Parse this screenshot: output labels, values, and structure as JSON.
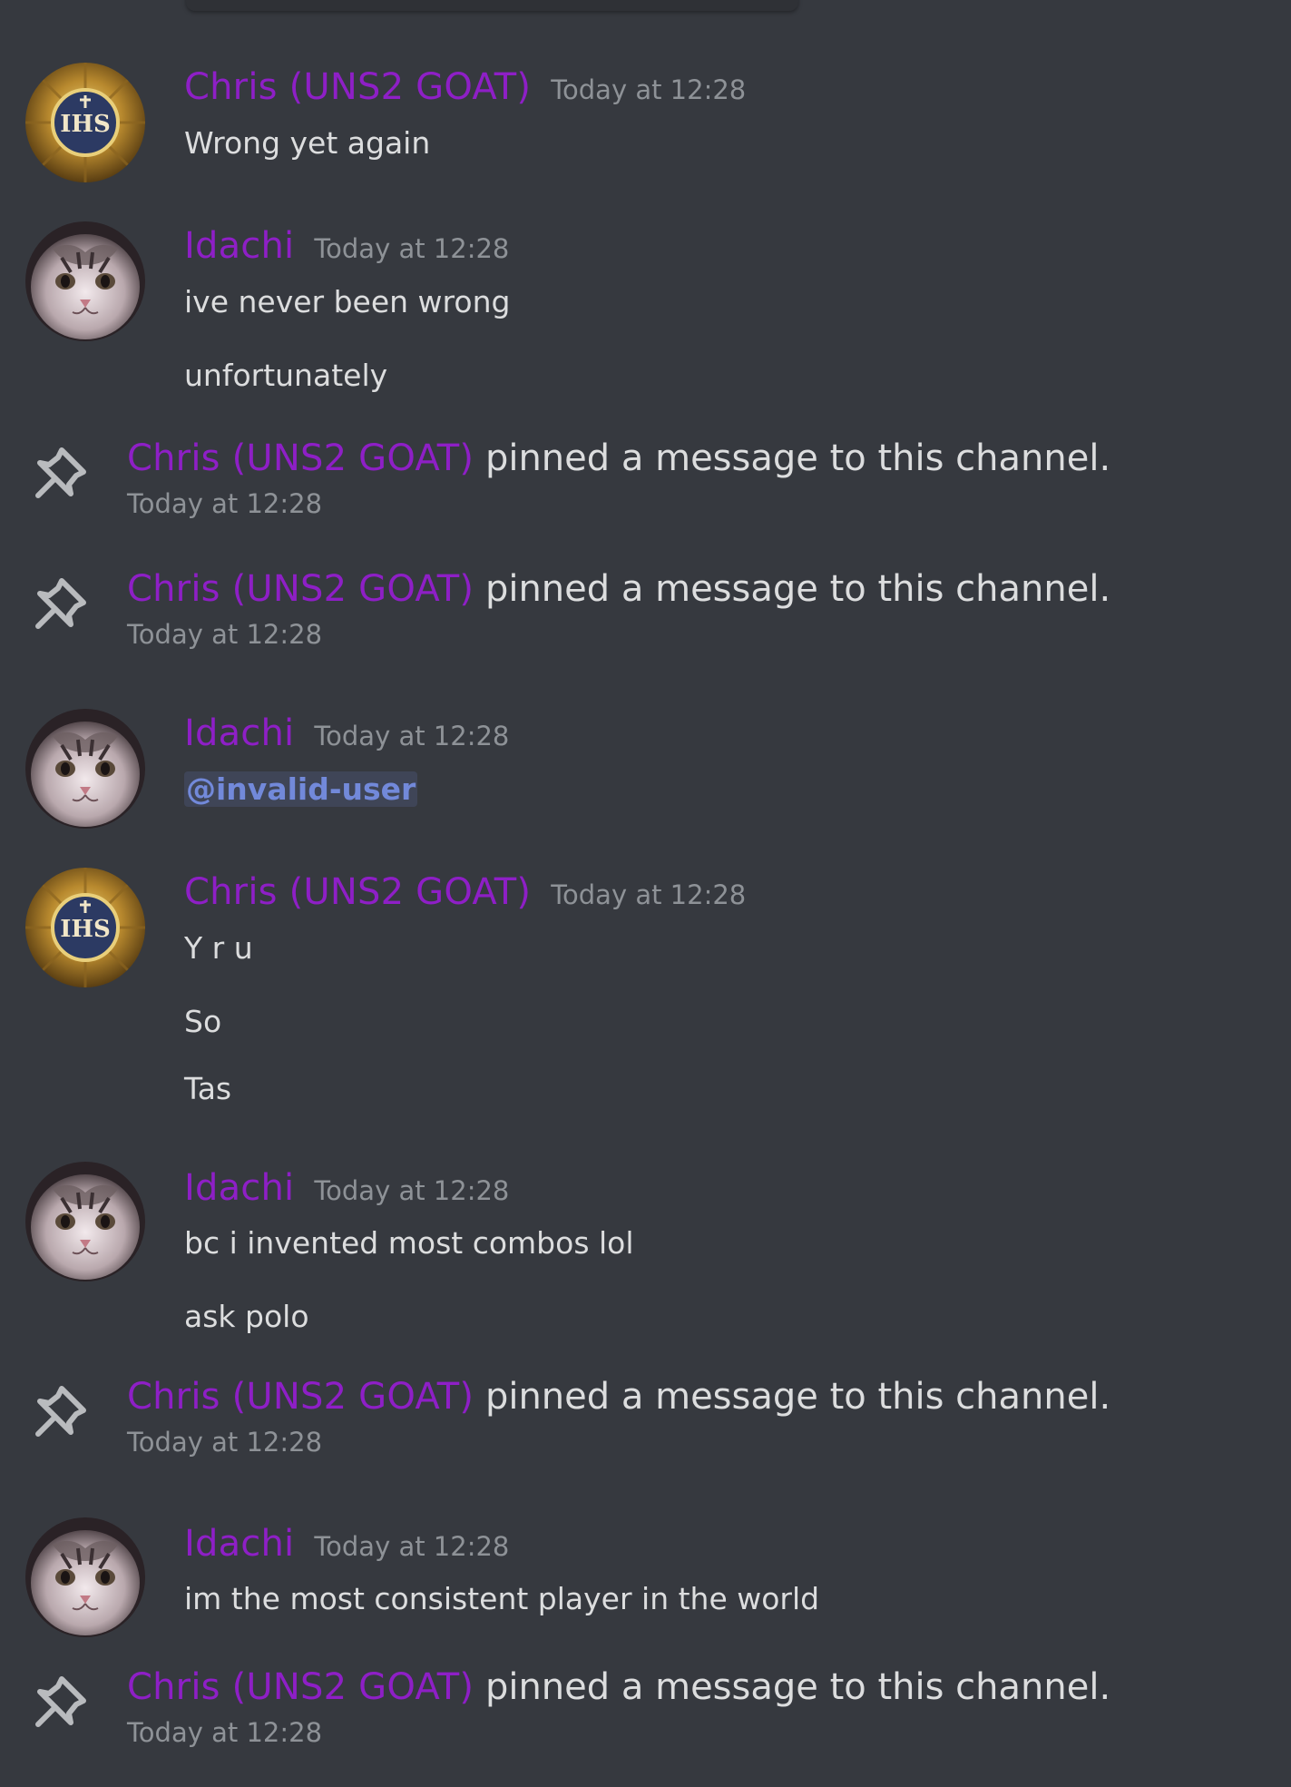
{
  "colors": {
    "background": "#36393f",
    "username": "#8e1fc6",
    "timestamp": "#8e9297",
    "text": "#dcddde",
    "mention": "#7289da"
  },
  "icons": {
    "pin": "pin-icon",
    "avatar_chris": "ihs-emblem-avatar",
    "avatar_idachi": "cat-avatar"
  },
  "pin_text": "pinned a message to this channel.",
  "messages": [
    {
      "author": "Chris (UNS2 GOAT)",
      "time": "Today at 12:28",
      "lines": [
        "Wrong yet again"
      ]
    },
    {
      "author": "Idachi",
      "time": "Today at 12:28",
      "lines": [
        "ive never been wrong",
        "unfortunately"
      ]
    },
    {
      "author": "Chris (UNS2 GOAT)",
      "time": "Today at 12:28"
    },
    {
      "author": "Chris (UNS2 GOAT)",
      "time": "Today at 12:28"
    },
    {
      "author": "Idachi",
      "time": "Today at 12:28",
      "lines": [
        "@invalid-user"
      ]
    },
    {
      "author": "Chris (UNS2 GOAT)",
      "time": "Today at 12:28",
      "lines": [
        "Y r u",
        "So",
        "Tas"
      ]
    },
    {
      "author": "Idachi",
      "time": "Today at 12:28",
      "lines": [
        "bc i invented most combos lol",
        "ask polo"
      ]
    },
    {
      "author": "Chris (UNS2 GOAT)",
      "time": "Today at 12:28"
    },
    {
      "author": "Idachi",
      "time": "Today at 12:28",
      "lines": [
        "im the most consistent player in the world"
      ]
    },
    {
      "author": "Chris (UNS2 GOAT)",
      "time": "Today at 12:28"
    }
  ]
}
